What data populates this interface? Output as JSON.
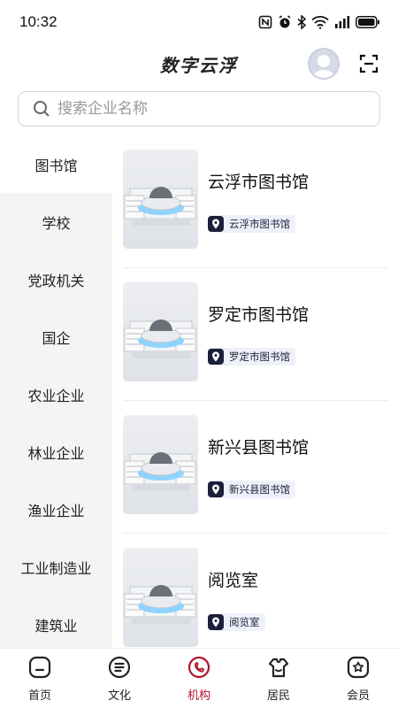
{
  "status_bar": {
    "time": "10:32",
    "icons": [
      "nfc-icon",
      "alarm-icon",
      "bluetooth-icon",
      "wifi-icon",
      "signal-icon",
      "battery-icon"
    ]
  },
  "header": {
    "title": "数字云浮"
  },
  "search": {
    "placeholder": "搜索企业名称",
    "value": ""
  },
  "sidebar": {
    "active_index": 0,
    "items": [
      {
        "label": "图书馆"
      },
      {
        "label": "学校"
      },
      {
        "label": "党政机关"
      },
      {
        "label": "国企"
      },
      {
        "label": "农业企业"
      },
      {
        "label": "林业企业"
      },
      {
        "label": "渔业企业"
      },
      {
        "label": "工业制造业"
      },
      {
        "label": "建筑业"
      }
    ]
  },
  "list": {
    "items": [
      {
        "title": "云浮市图书馆",
        "tag": "云浮市图书馆"
      },
      {
        "title": "罗定市图书馆",
        "tag": "罗定市图书馆"
      },
      {
        "title": "新兴县图书馆",
        "tag": "新兴县图书馆"
      },
      {
        "title": "阅览室",
        "tag": "阅览室"
      }
    ]
  },
  "bottom_nav": {
    "active_index": 2,
    "items": [
      {
        "label": "首页",
        "icon": "home-icon"
      },
      {
        "label": "文化",
        "icon": "culture-icon"
      },
      {
        "label": "机构",
        "icon": "institution-icon"
      },
      {
        "label": "居民",
        "icon": "resident-icon"
      },
      {
        "label": "会员",
        "icon": "member-icon"
      }
    ]
  },
  "colors": {
    "accent": "#b0132c",
    "sidebar_bg": "#f4f4f4",
    "tag_bg": "#eef1f9",
    "tag_icon": "#1c1f3a"
  }
}
